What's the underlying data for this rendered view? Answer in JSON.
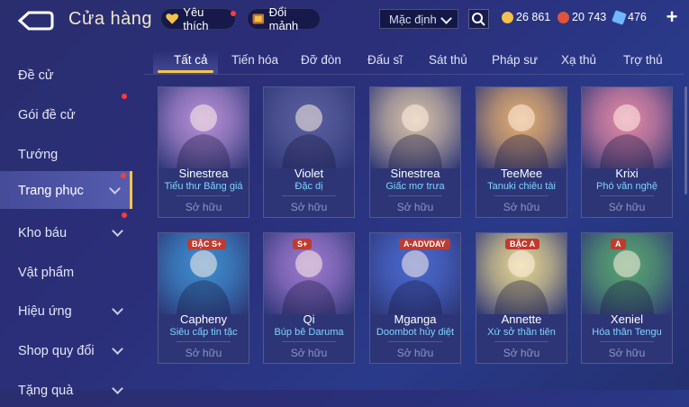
{
  "header": {
    "title": "Cửa hàng",
    "favorites_label": "Yêu thích",
    "exchange_label": "Đổi mảnh",
    "sort_value": "Mặc định",
    "currency": [
      {
        "value": "26 861",
        "color": "#f2c14b",
        "icon": "gold-coin-icon"
      },
      {
        "value": "20 743",
        "color": "#e0533c",
        "icon": "voucher-icon"
      },
      {
        "value": "476",
        "color": "#6fb7ff",
        "icon": "diamond-icon"
      }
    ]
  },
  "sidebar": {
    "items": [
      {
        "label": "Đề cử",
        "arrow": false,
        "dot": false
      },
      {
        "label": "Gói đề cử",
        "arrow": false,
        "dot": true
      },
      {
        "label": "Tướng",
        "arrow": false,
        "dot": false
      },
      {
        "label": "Trang phục",
        "arrow": true,
        "dot": true,
        "active": true
      },
      {
        "label": "Kho báu",
        "arrow": true,
        "dot": true
      },
      {
        "label": "Vật phẩm",
        "arrow": false,
        "dot": false
      },
      {
        "label": "Hiệu ứng",
        "arrow": true,
        "dot": false
      },
      {
        "label": "Shop quy đổi",
        "arrow": true,
        "dot": false
      },
      {
        "label": "Tặng quà",
        "arrow": true,
        "dot": false
      }
    ]
  },
  "tabs": [
    "Tất cả",
    "Tiến hóa",
    "Đỡ đòn",
    "Đấu sĩ",
    "Sát thủ",
    "Pháp sư",
    "Xạ thủ",
    "Trợ thủ"
  ],
  "cards": [
    {
      "hero": "Sinestrea",
      "skin": "Tiểu thư Băng giá",
      "status": "Sở hữu",
      "badge": "",
      "color": "#b890d8"
    },
    {
      "hero": "Violet",
      "skin": "Đặc dị",
      "status": "Sở hữu",
      "badge": "",
      "color": "#5a5f9e"
    },
    {
      "hero": "Sinestrea",
      "skin": "Giấc mơ trưa",
      "status": "Sở hữu",
      "badge": "",
      "color": "#d8c2a8"
    },
    {
      "hero": "TeeMee",
      "skin": "Tanuki chiêu tài",
      "status": "Sở hữu",
      "badge": "",
      "color": "#e8b070"
    },
    {
      "hero": "Krixi",
      "skin": "Phó văn nghệ",
      "status": "Sở hữu",
      "badge": "",
      "color": "#e88aa8"
    },
    {
      "hero": "Capheny",
      "skin": "Siêu cấp tin tặc",
      "status": "Sở hữu",
      "badge": "BẬC S+",
      "color": "#3e8fd0"
    },
    {
      "hero": "Qi",
      "skin": "Búp bê Daruma",
      "status": "Sở hữu",
      "badge": "S+",
      "color": "#a07ad0"
    },
    {
      "hero": "Mganga",
      "skin": "Doombot hủy diệt",
      "status": "Sở hữu",
      "badge": "A-ADVDAY",
      "color": "#4a6ad0"
    },
    {
      "hero": "Annette",
      "skin": "Xứ sở thần tiên",
      "status": "Sở hữu",
      "badge": "BẬC A",
      "color": "#e8d890"
    },
    {
      "hero": "Xeniel",
      "skin": "Hóa thân Tengu",
      "status": "Sở hữu",
      "badge": "A",
      "color": "#5aa870"
    }
  ]
}
